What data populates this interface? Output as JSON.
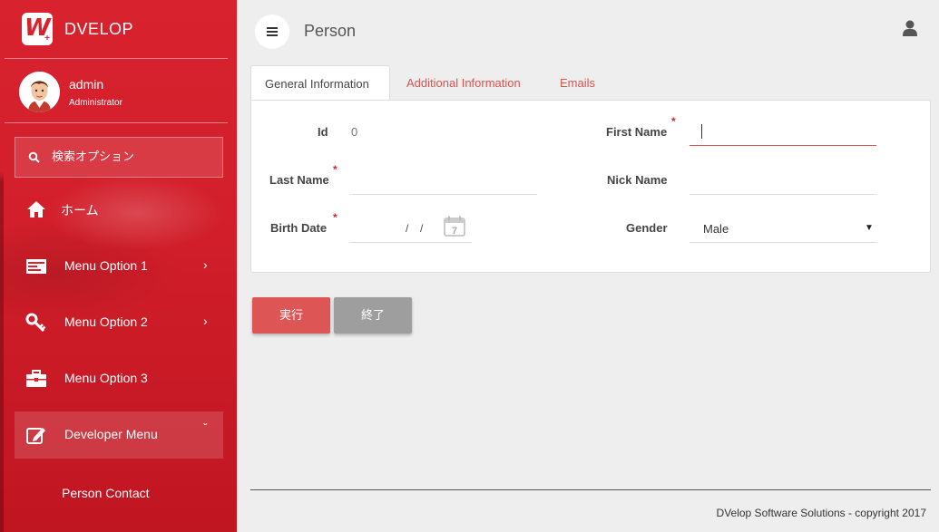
{
  "sidebar": {
    "brand": "DVELOP",
    "logo_letter": "W",
    "user": {
      "name": "admin",
      "role": "Administrator"
    },
    "search_placeholder": "検索オプション",
    "items": [
      {
        "label": "ホーム",
        "icon": "home-icon"
      },
      {
        "label": "Menu Option 1",
        "icon": "list-icon",
        "chevron": "›"
      },
      {
        "label": "Menu Option 2",
        "icon": "key-icon",
        "chevron": "›"
      },
      {
        "label": "Menu Option 3",
        "icon": "briefcase-icon"
      },
      {
        "label": "Developer Menu",
        "icon": "edit-icon",
        "chevron": "ˇ"
      }
    ],
    "subitem": "Person Contact"
  },
  "header": {
    "title": "Person"
  },
  "tabs": [
    {
      "label": "General Information",
      "active": true
    },
    {
      "label": "Additional Information",
      "active": false
    },
    {
      "label": "Emails",
      "active": false
    }
  ],
  "form": {
    "id": {
      "label": "Id",
      "value": "0"
    },
    "first_name": {
      "label": "First Name",
      "required": "*"
    },
    "last_name": {
      "label": "Last Name",
      "required": "*"
    },
    "nick_name": {
      "label": "Nick Name"
    },
    "birth_date": {
      "label": "Birth Date",
      "required": "*",
      "sep1": "/",
      "sep2": "/",
      "calendar_day": "7"
    },
    "gender": {
      "label": "Gender",
      "value": "Male",
      "arrow": "▼"
    }
  },
  "buttons": {
    "run": "実行",
    "end": "終了"
  },
  "footer": "DVelop Software Solutions - copyright 2017",
  "colors": {
    "sidebar": "#d8232f",
    "accent": "#d9534f",
    "run_button": "#dd5555",
    "end_button": "#9e9e9e"
  }
}
